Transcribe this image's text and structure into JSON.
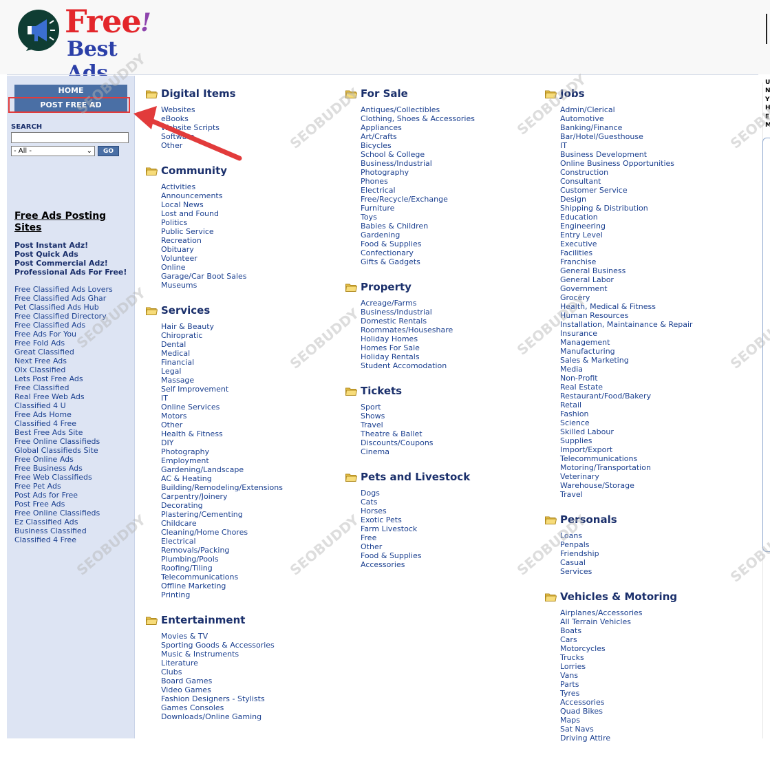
{
  "logo": {
    "free": "Free",
    "exclaim": "!",
    "best": "Best Ads"
  },
  "sidebar": {
    "home": "HOME",
    "post_free_ad": "POST FREE AD",
    "search_label": "SEARCH",
    "search_value": "",
    "select_value": "- All -",
    "go": "GO",
    "sites_title": "Free Ads Posting Sites",
    "post_links": [
      "Post Instant Adz!",
      "Post Quick Ads",
      "Post Commercial Adz!",
      "Professional Ads For Free!"
    ],
    "site_links": [
      "Free Classified Ads Lovers",
      "Free Classified Ads Ghar",
      "Pet Classified Ads Hub",
      "Free Classified Directory",
      "Free Classified Ads",
      "Free Ads For You",
      "Free Fold Ads",
      "Great Classified",
      "Next Free Ads",
      "Olx Classified",
      "Lets Post Free Ads",
      "Free Classified",
      "Real Free Web Ads",
      "Classified 4 U",
      "Free Ads Home",
      "Classified 4 Free",
      "Best Free Ads Site",
      "Free Online Classifieds",
      "Global Classifieds Site",
      "Free Online Ads",
      "Free Business Ads",
      "Free Web Classifieds",
      "Free Pet Ads",
      "Post Ads for Free",
      "Post Free Ads",
      "Free Online Classifieds",
      "Ez Classified Ads",
      "Business Classified",
      "Classified 4 Free"
    ]
  },
  "columns": [
    [
      {
        "title": "Digital Items",
        "items": [
          "Websites",
          "eBooks",
          "Website Scripts",
          "Software",
          "Other"
        ]
      },
      {
        "title": "Community",
        "items": [
          "Activities",
          "Announcements",
          "Local News",
          "Lost and Found",
          "Politics",
          "Public Service",
          "Recreation",
          "Obituary",
          "Volunteer",
          "Online",
          "Garage/Car Boot Sales",
          "Museums"
        ]
      },
      {
        "title": "Services",
        "items": [
          "Hair & Beauty",
          "Chiropratic",
          "Dental",
          "Medical",
          "Financial",
          "Legal",
          "Massage",
          "Self Improvement",
          "IT",
          "Online Services",
          "Motors",
          "Other",
          "Health & Fitness",
          "DIY",
          "Photography",
          "Employment",
          "Gardening/Landscape",
          "AC & Heating",
          "Building/Remodeling/Extensions",
          "Carpentry/Joinery",
          "Decorating",
          "Plastering/Cementing",
          "Childcare",
          "Cleaning/Home Chores",
          "Electrical",
          "Removals/Packing",
          "Plumbing/Pools",
          "Roofing/Tiling",
          "Telecommunications",
          "Offline Marketing",
          "Printing"
        ]
      },
      {
        "title": "Entertainment",
        "items": [
          "Movies & TV",
          "Sporting Goods & Accessories",
          "Music & Instruments",
          "Literature",
          "Clubs",
          "Board Games",
          "Video Games",
          "Fashion Designers - Stylists",
          "Games Consoles",
          "Downloads/Online Gaming"
        ]
      }
    ],
    [
      {
        "title": "For Sale",
        "items": [
          "Antiques/Collectibles",
          "Clothing, Shoes & Accessories",
          "Appliances",
          "Art/Crafts",
          "Bicycles",
          "School & College",
          "Business/Industrial",
          "Photography",
          "Phones",
          "Electrical",
          "Free/Recycle/Exchange",
          "Furniture",
          "Toys",
          "Babies & Children",
          "Gardening",
          "Food & Supplies",
          "Confectionary",
          "Gifts & Gadgets"
        ]
      },
      {
        "title": "Property",
        "items": [
          "Acreage/Farms",
          "Business/Industrial",
          "Domestic Rentals",
          "Roommates/Houseshare",
          "Holiday Homes",
          "Homes For Sale",
          "Holiday Rentals",
          "Student Accomodation"
        ]
      },
      {
        "title": "Tickets",
        "items": [
          "Sport",
          "Shows",
          "Travel",
          "Theatre & Ballet",
          "Discounts/Coupons",
          "Cinema"
        ]
      },
      {
        "title": "Pets and Livestock",
        "items": [
          "Dogs",
          "Cats",
          "Horses",
          "Exotic Pets",
          "Farm Livestock",
          "Free",
          "Other",
          "Food & Supplies",
          "Accessories"
        ]
      }
    ],
    [
      {
        "title": "Jobs",
        "items": [
          "Admin/Clerical",
          "Automotive",
          "Banking/Finance",
          "Bar/Hotel/Guesthouse",
          "IT",
          "Business Development",
          "Online Business Opportunities",
          "Construction",
          "Consultant",
          "Customer Service",
          "Design",
          "Shipping & Distribution",
          "Education",
          "Engineering",
          "Entry Level",
          "Executive",
          "Facilities",
          "Franchise",
          "General Business",
          "General Labor",
          "Government",
          "Grocery",
          "Health, Medical & Fitness",
          "Human Resources",
          "Installation, Maintainance & Repair",
          "Insurance",
          "Management",
          "Manufacturing",
          "Sales & Marketing",
          "Media",
          "Non-Profit",
          "Real Estate",
          "Restaurant/Food/Bakery",
          "Retail",
          "Fashion",
          "Science",
          "Skilled Labour",
          "Supplies",
          "Import/Export",
          "Telecommunications",
          "Motoring/Transportation",
          "Veterinary",
          "Warehouse/Storage",
          "Travel"
        ]
      },
      {
        "title": "Personals",
        "items": [
          "Loans",
          "Penpals",
          "Friendship",
          "Casual",
          "Services"
        ]
      },
      {
        "title": "Vehicles & Motoring",
        "items": [
          "Airplanes/Accessories",
          "All Terrain Vehicles",
          "Boats",
          "Cars",
          "Motorcycles",
          "Trucks",
          "Lorries",
          "Vans",
          "Parts",
          "Tyres",
          "Accessories",
          "Quad Bikes",
          "Maps",
          "Sat Navs",
          "Driving Attire"
        ]
      }
    ]
  ],
  "right_edge_letters": [
    "U",
    "N",
    "Y",
    "H",
    "E",
    "M"
  ],
  "watermark": "SEOBUDDY",
  "colors": {
    "sidebar_bg": "#dde4f3",
    "button_bg": "#4a6fa5",
    "link": "#1a3f8f",
    "heading": "#1a2f6b",
    "highlight": "#e23b3b"
  }
}
